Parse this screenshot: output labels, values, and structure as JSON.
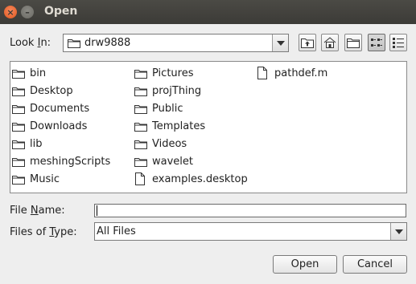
{
  "window": {
    "title": "Open"
  },
  "look_in": {
    "label_pre": "Look ",
    "label_mnemonic": "I",
    "label_post": "n:",
    "value": "drw9888"
  },
  "toolbar": {
    "buttons": [
      {
        "name": "up-one-level-icon"
      },
      {
        "name": "home-icon"
      },
      {
        "name": "new-folder-icon"
      },
      {
        "name": "list-view-icon",
        "active": true
      },
      {
        "name": "details-view-icon",
        "active": false
      }
    ]
  },
  "files": {
    "column1": [
      "bin",
      "Desktop",
      "Documents",
      "Downloads",
      "lib",
      "meshingScripts",
      "Music"
    ],
    "column2": [
      "Pictures",
      "projThing",
      "Public",
      "Templates",
      "Videos",
      "wavelet",
      "examples.desktop"
    ],
    "column3": [
      "pathdef.m"
    ]
  },
  "file_name": {
    "label_pre": "File ",
    "label_mnemonic": "N",
    "label_post": "ame:",
    "value": ""
  },
  "file_type": {
    "label_pre": "Files of ",
    "label_mnemonic": "T",
    "label_post": "ype:",
    "value": "All Files"
  },
  "buttons": {
    "open": "Open",
    "cancel": "Cancel"
  },
  "colors": {
    "titlebar": "#3c3b37",
    "close": "#e0571d",
    "background": "#eeeeee"
  }
}
